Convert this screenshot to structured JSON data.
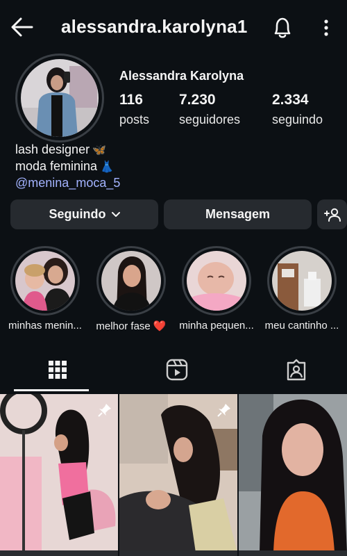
{
  "header": {
    "username": "alessandra.karolyna1",
    "back_icon": "arrow-left-icon",
    "bell_icon": "bell-icon",
    "more_icon": "more-vertical-icon"
  },
  "profile": {
    "full_name": "Alessandra Karolyna",
    "posts_count": "116",
    "posts_label": "posts",
    "followers_count": "7.230",
    "followers_label": "seguidores",
    "following_count": "2.334",
    "following_label": "seguindo",
    "bio_line1": "lash designer",
    "bio_emoji1": "🦋",
    "bio_line2": "moda feminina",
    "bio_emoji2": "👗",
    "bio_link": "@menina_moca_5"
  },
  "actions": {
    "following_label": "Seguindo",
    "message_label": "Mensagem",
    "add_user_icon": "person-add-icon"
  },
  "highlights": [
    {
      "label": "minhas menin..."
    },
    {
      "label": "melhor fase ❤️"
    },
    {
      "label": "minha pequen..."
    },
    {
      "label": "meu cantinho ..."
    }
  ],
  "tabs": [
    {
      "icon": "grid-icon",
      "active": true
    },
    {
      "icon": "reels-icon",
      "active": false
    },
    {
      "icon": "tagged-icon",
      "active": false
    }
  ],
  "colors": {
    "background": "#0c1014",
    "button_bg": "#262a2f",
    "link": "#a3b3ff",
    "ring": "#3a3f45"
  }
}
